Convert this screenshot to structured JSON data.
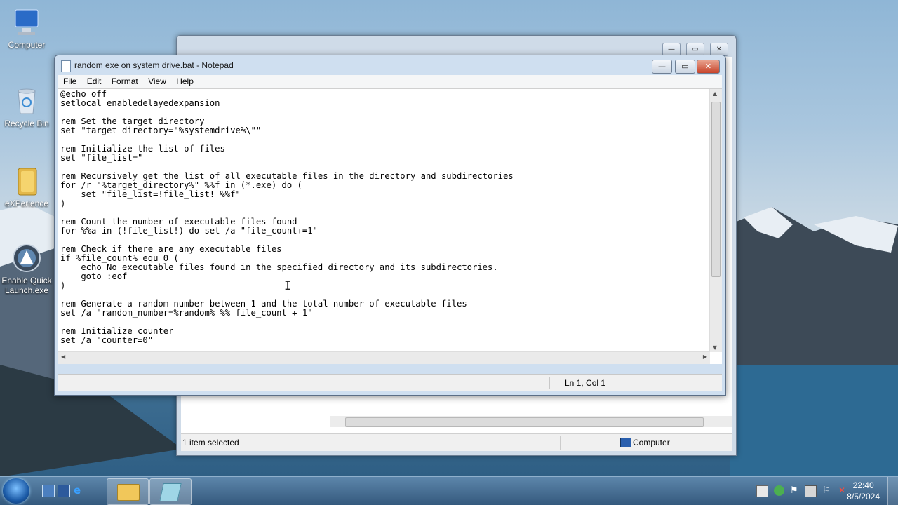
{
  "desktop": {
    "icons": [
      {
        "label": "Computer"
      },
      {
        "label": "Recycle Bin"
      },
      {
        "label": "eXPerience"
      },
      {
        "label": "Enable Quick Launch.exe"
      }
    ]
  },
  "explorer": {
    "status_left": "1 item selected",
    "status_right": "Computer"
  },
  "notepad": {
    "title": "random exe on system drive.bat - Notepad",
    "buttons": {
      "minimize": "—",
      "maximize": "▭",
      "close": "✕"
    },
    "menu": [
      "File",
      "Edit",
      "Format",
      "View",
      "Help"
    ],
    "code": "@echo off\nsetlocal enabledelayedexpansion\n\nrem Set the target directory\nset \"target_directory=\"%systemdrive%\\\"\"\n\nrem Initialize the list of files\nset \"file_list=\"\n\nrem Recursively get the list of all executable files in the directory and subdirectories\nfor /r \"%target_directory%\" %%f in (*.exe) do (\n    set \"file_list=!file_list! %%f\"\n)\n\nrem Count the number of executable files found\nfor %%a in (!file_list!) do set /a \"file_count+=1\"\n\nrem Check if there are any executable files\nif %file_count% equ 0 (\n    echo No executable files found in the specified directory and its subdirectories.\n    goto :eof\n)\n\nrem Generate a random number between 1 and the total number of executable files\nset /a \"random_number=%random% %% file_count + 1\"\n\nrem Initialize counter\nset /a \"counter=0\"",
    "status_position": "Ln 1, Col 1"
  },
  "taskbar": {
    "time": "22:40",
    "date": "8/5/2024"
  }
}
